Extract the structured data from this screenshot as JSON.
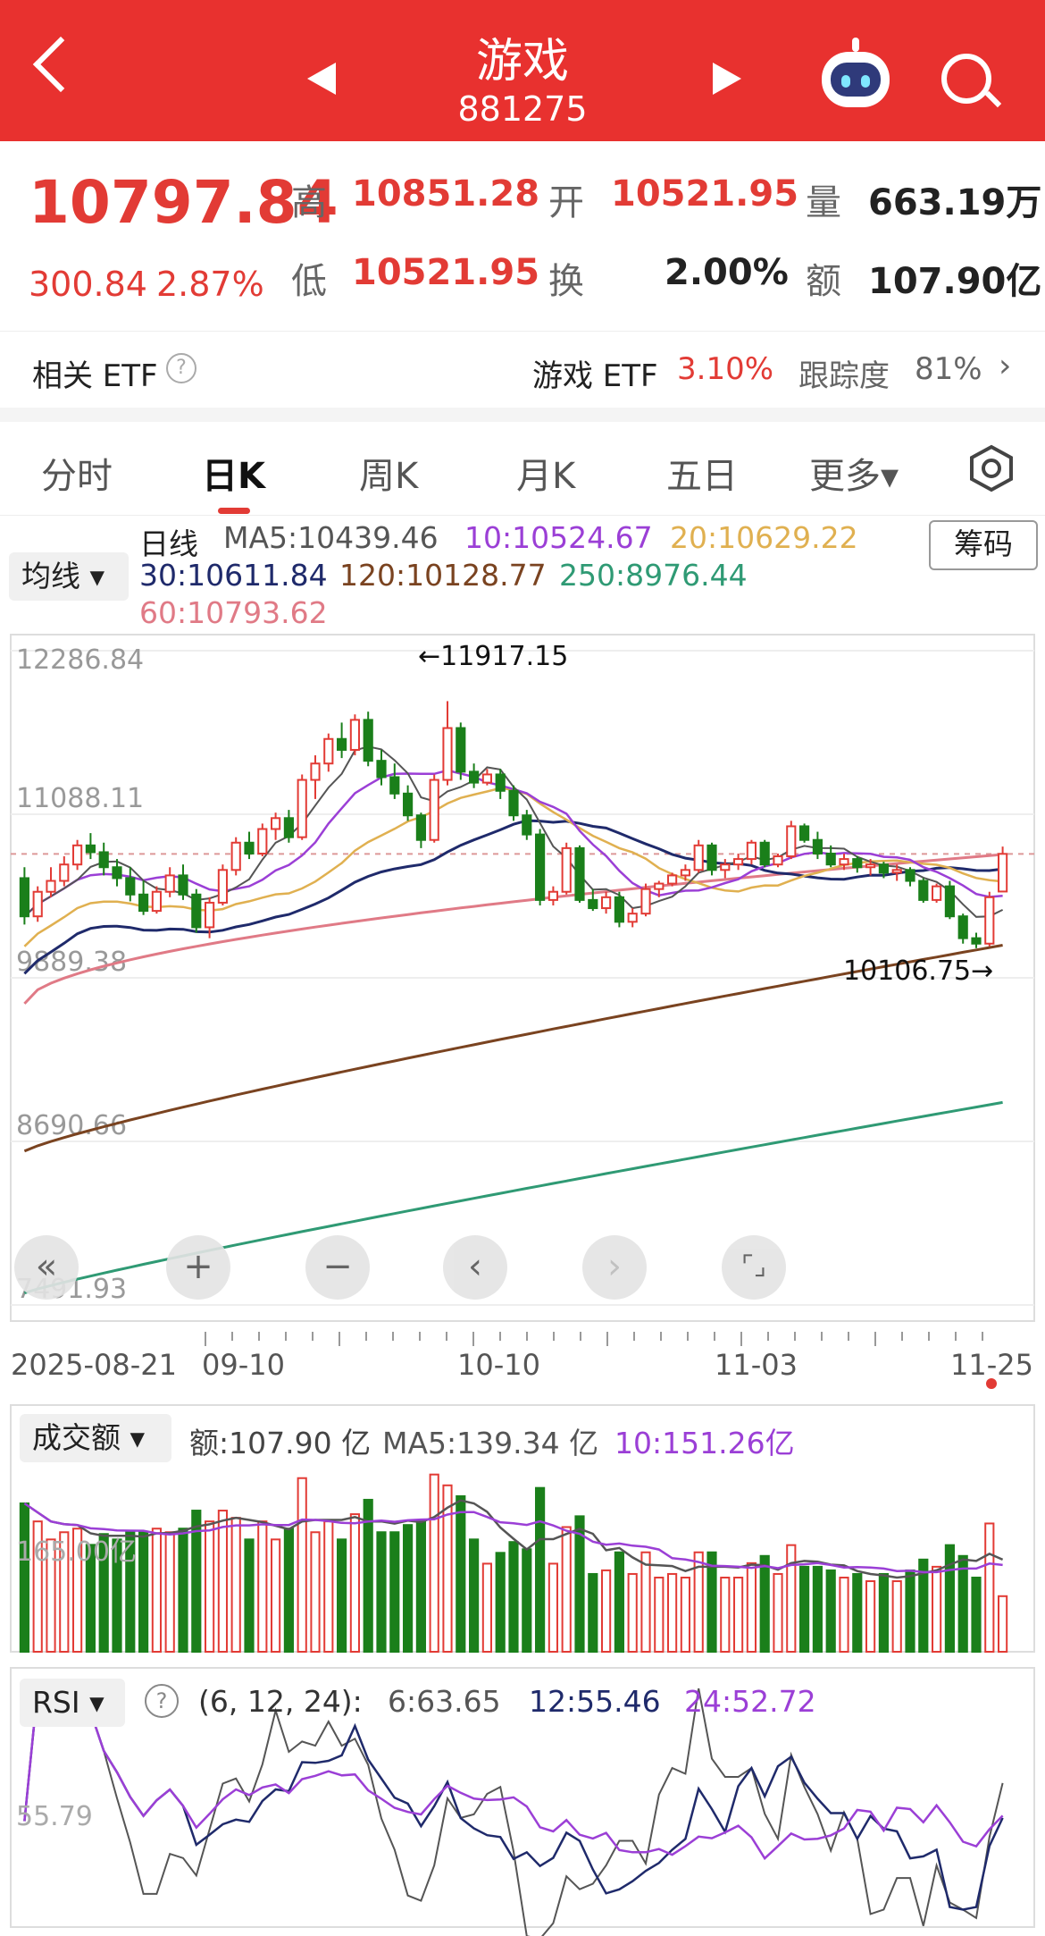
{
  "header": {
    "title": "游戏",
    "code": "881275"
  },
  "quote": {
    "price": "10797.84",
    "change": "300.84",
    "change_pct": "2.87%",
    "high_label": "高",
    "high": "10851.28",
    "low_label": "低",
    "low": "10521.95",
    "open_label": "开",
    "open": "10521.95",
    "turnover_label": "换",
    "turnover": "2.00%",
    "volume_label": "量",
    "volume": "663.19万",
    "amount_label": "额",
    "amount": "107.90亿"
  },
  "etf": {
    "label": "相关 ETF",
    "name": "游戏 ETF",
    "pct": "3.10%",
    "track_label": "跟踪度",
    "track": "81%"
  },
  "tabs": [
    "分时",
    "日K",
    "周K",
    "月K",
    "五日",
    "更多▾"
  ],
  "kline": {
    "pill": "均线 ▾",
    "chip_button": "筹码",
    "line_label": "日线",
    "ma5": "MA5:10439.46",
    "ma10": "10:10524.67",
    "ma20": "20:10629.22",
    "ma30": "30:10611.84",
    "ma120": "120:10128.77",
    "ma250": "250:8976.44",
    "ma60": "60:10793.62",
    "y_ticks": [
      "12286.84",
      "11088.11",
      "9889.38",
      "8690.66",
      "7491.93"
    ],
    "max_label": "←11917.15",
    "min_label": "10106.75→",
    "x_ticks": [
      "2025-08-21",
      "09-10",
      "10-10",
      "11-03",
      "11-25"
    ]
  },
  "controls": [
    "«",
    "+",
    "−",
    "‹",
    "›",
    "⌜⌟"
  ],
  "volume_panel": {
    "pill": "成交额 ▾",
    "amount": "额:107.90 亿",
    "ma5": "MA5:139.34 亿",
    "ma10": "10:151.26亿",
    "axis": "165.00亿"
  },
  "rsi_panel": {
    "pill": "RSI ▾",
    "params": "(6, 12, 24):",
    "rsi6": "6:63.65",
    "rsi12": "12:55.46",
    "rsi24": "24:52.72",
    "axis": "55.79"
  },
  "colors": {
    "red": "#e23b35",
    "green": "#1a7f1a",
    "ma5": "#555555",
    "ma10": "#9b3fd6",
    "ma20": "#e0b050",
    "ma30": "#1f2a6b",
    "ma60": "#e07a86",
    "ma120": "#7a4320",
    "ma250": "#2f9a74"
  },
  "chart_data": {
    "type": "candlestick",
    "x_ticks": [
      "2025-08-21",
      "09-10",
      "10-10",
      "11-03",
      "11-25"
    ],
    "ylim": [
      7491.93,
      12286.84
    ],
    "last": {
      "open": 10521.95,
      "high": 10851.28,
      "low": 10521.95,
      "close": 10797.84
    },
    "period_high": 11917.15,
    "period_low": 10106.75,
    "ma_latest": {
      "MA5": 10439.46,
      "MA10": 10524.67,
      "MA20": 10629.22,
      "MA30": 10611.84,
      "MA60": 10793.62,
      "MA120": 10128.77,
      "MA250": 8976.44
    },
    "ohlc": [
      [
        10620,
        10700,
        10280,
        10340
      ],
      [
        10340,
        10560,
        10300,
        10520
      ],
      [
        10520,
        10700,
        10480,
        10600
      ],
      [
        10600,
        10780,
        10560,
        10720
      ],
      [
        10720,
        10900,
        10680,
        10860
      ],
      [
        10860,
        10950,
        10760,
        10810
      ],
      [
        10810,
        10880,
        10640,
        10700
      ],
      [
        10700,
        10760,
        10560,
        10620
      ],
      [
        10620,
        10700,
        10450,
        10500
      ],
      [
        10500,
        10600,
        10350,
        10380
      ],
      [
        10380,
        10560,
        10360,
        10520
      ],
      [
        10520,
        10700,
        10480,
        10640
      ],
      [
        10640,
        10720,
        10460,
        10500
      ],
      [
        10500,
        10540,
        10220,
        10260
      ],
      [
        10260,
        10480,
        10180,
        10440
      ],
      [
        10440,
        10720,
        10420,
        10680
      ],
      [
        10680,
        10920,
        10640,
        10880
      ],
      [
        10880,
        10960,
        10760,
        10800
      ],
      [
        10800,
        11020,
        10780,
        10980
      ],
      [
        10980,
        11100,
        10900,
        11060
      ],
      [
        11060,
        11120,
        10880,
        10920
      ],
      [
        10920,
        11380,
        10900,
        11340
      ],
      [
        11340,
        11520,
        11200,
        11460
      ],
      [
        11460,
        11680,
        11400,
        11640
      ],
      [
        11640,
        11760,
        11500,
        11560
      ],
      [
        11560,
        11820,
        11520,
        11780
      ],
      [
        11780,
        11840,
        11440,
        11480
      ],
      [
        11480,
        11560,
        11300,
        11360
      ],
      [
        11360,
        11460,
        11200,
        11240
      ],
      [
        11240,
        11300,
        11040,
        11080
      ],
      [
        11080,
        11100,
        10840,
        10900
      ],
      [
        10900,
        11380,
        10880,
        11340
      ],
      [
        11340,
        11917.15,
        11300,
        11720
      ],
      [
        11720,
        11760,
        11340,
        11400
      ],
      [
        11400,
        11460,
        11280,
        11320
      ],
      [
        11320,
        11420,
        11300,
        11380
      ],
      [
        11380,
        11420,
        11200,
        11260
      ],
      [
        11260,
        11300,
        11040,
        11080
      ],
      [
        11080,
        11120,
        10900,
        10940
      ],
      [
        10940,
        10980,
        10420,
        10460
      ],
      [
        10460,
        10560,
        10420,
        10520
      ],
      [
        10520,
        10880,
        10500,
        10840
      ],
      [
        10840,
        10860,
        10440,
        10460
      ],
      [
        10460,
        10540,
        10380,
        10400
      ],
      [
        10400,
        10520,
        10360,
        10480
      ],
      [
        10480,
        10520,
        10260,
        10300
      ],
      [
        10300,
        10400,
        10260,
        10360
      ],
      [
        10360,
        10580,
        10340,
        10540
      ],
      [
        10540,
        10600,
        10480,
        10580
      ],
      [
        10580,
        10660,
        10560,
        10640
      ],
      [
        10640,
        10720,
        10600,
        10680
      ],
      [
        10680,
        10900,
        10660,
        10860
      ],
      [
        10860,
        10880,
        10640,
        10680
      ],
      [
        10680,
        10760,
        10620,
        10720
      ],
      [
        10720,
        10800,
        10680,
        10760
      ],
      [
        10760,
        10900,
        10720,
        10880
      ],
      [
        10880,
        10900,
        10700,
        10720
      ],
      [
        10720,
        10800,
        10700,
        10780
      ],
      [
        10780,
        11040,
        10760,
        11000
      ],
      [
        11000,
        11020,
        10880,
        10900
      ],
      [
        10900,
        10960,
        10760,
        10800
      ],
      [
        10800,
        10860,
        10700,
        10720
      ],
      [
        10720,
        10800,
        10680,
        10760
      ],
      [
        10760,
        10780,
        10660,
        10700
      ],
      [
        10700,
        10760,
        10640,
        10720
      ],
      [
        10720,
        10740,
        10620,
        10660
      ],
      [
        10660,
        10720,
        10600,
        10680
      ],
      [
        10680,
        10700,
        10560,
        10600
      ],
      [
        10600,
        10620,
        10440,
        10460
      ],
      [
        10460,
        10580,
        10440,
        10560
      ],
      [
        10560,
        10600,
        10320,
        10340
      ],
      [
        10340,
        10360,
        10140,
        10180
      ],
      [
        10180,
        10220,
        10106.75,
        10140
      ],
      [
        10140,
        10520,
        10120,
        10480
      ],
      [
        10521.95,
        10851.28,
        10521.95,
        10797.84
      ]
    ],
    "amount_ma": {
      "MA5": 139.34,
      "MA10": 151.26,
      "latest": 107.9,
      "unit": "亿"
    },
    "rsi": {
      "RSI6": 63.65,
      "RSI12": 55.46,
      "RSI24": 52.72
    }
  }
}
